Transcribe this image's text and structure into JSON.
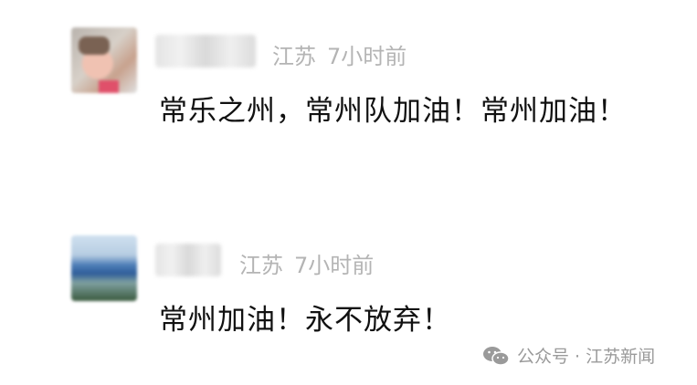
{
  "comments": [
    {
      "location": "江苏",
      "time": "7小时前",
      "text": "常乐之州，常州队加油！常州加油！"
    },
    {
      "location": "江苏",
      "time": "7小时前",
      "text": "常州加油！永不放弃！"
    }
  ],
  "watermark": {
    "text": "公众号 · 江苏新闻",
    "icon": "wechat-icon"
  }
}
